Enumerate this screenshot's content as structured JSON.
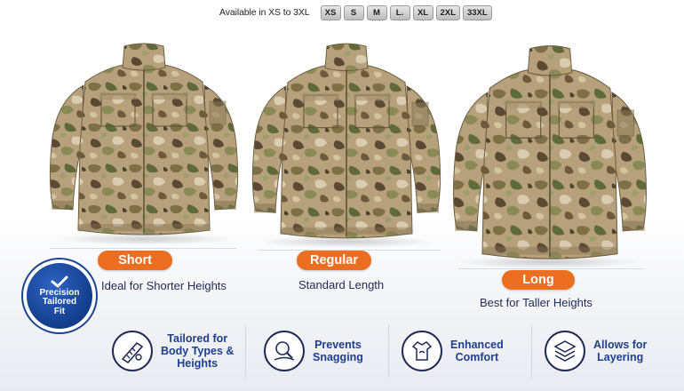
{
  "sizes": {
    "label": "Available in XS to 3XL",
    "options": [
      "XS",
      "S",
      "M",
      "L.",
      "XL",
      "2XL",
      "33XL"
    ]
  },
  "fits": [
    {
      "name": "Short",
      "description": "Ideal for Shorter Heights"
    },
    {
      "name": "Regular",
      "description": "Standard Length"
    },
    {
      "name": "Long",
      "description": "Best for Taller Heights"
    }
  ],
  "badge": {
    "line1": "Precision",
    "line2": "Tailored",
    "line3": "Fit"
  },
  "features": [
    {
      "icon": "tailored-fit-icon",
      "lines": [
        "Tailored for",
        "Body Types &",
        "Heights"
      ]
    },
    {
      "icon": "prevents-snagging-icon",
      "lines": [
        "Prevents",
        "Snagging"
      ]
    },
    {
      "icon": "enhanced-comfort-icon",
      "lines": [
        "Enhanced",
        "Comfort"
      ]
    },
    {
      "icon": "layering-icon",
      "lines": [
        "Allows for",
        "Layering"
      ]
    }
  ],
  "colors": {
    "accent": "#ec6e21",
    "navy": "#1c3f8f",
    "camo_base": "#b9a27e"
  }
}
